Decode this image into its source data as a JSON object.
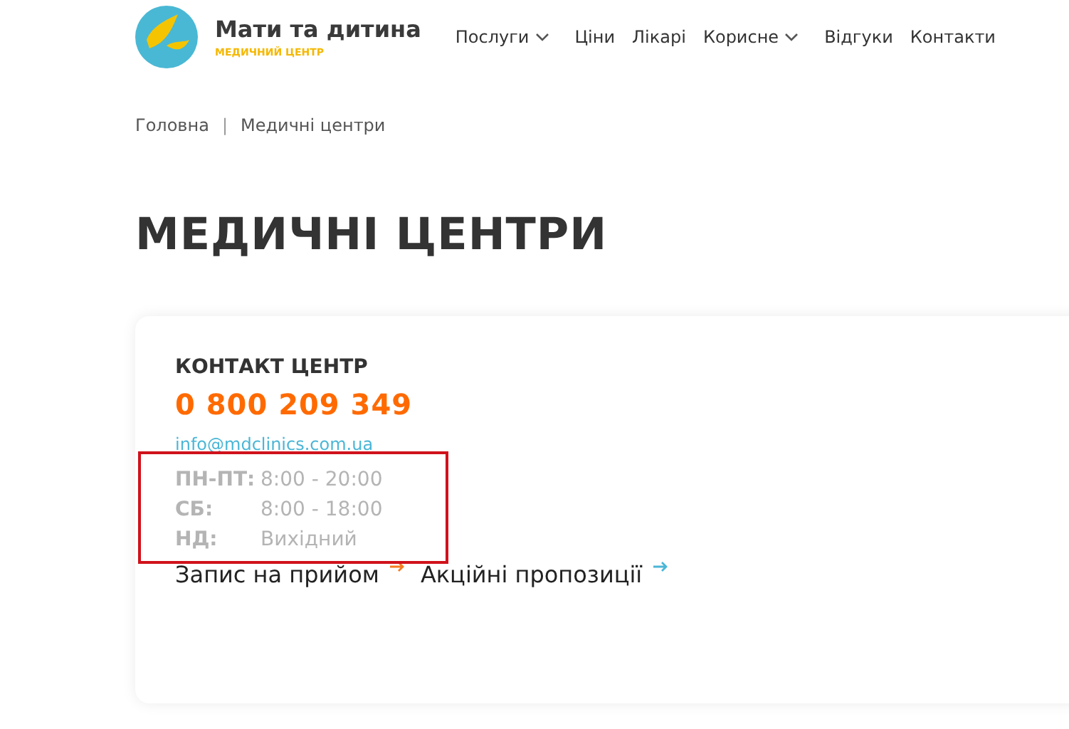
{
  "header": {
    "brand": "Мати та дитина",
    "tagline": "МЕДИЧНИЙ ЦЕНТР",
    "nav": [
      {
        "label": "Послуги",
        "dropdown": true
      },
      {
        "label": "Ціни",
        "dropdown": false
      },
      {
        "label": "Лікарі",
        "dropdown": false
      },
      {
        "label": "Корисне",
        "dropdown": true
      },
      {
        "label": "Відгуки",
        "dropdown": false
      },
      {
        "label": "Контакти",
        "dropdown": false
      }
    ]
  },
  "breadcrumbs": [
    "Головна",
    "Медичні центри"
  ],
  "breadcrumb_separator": "|",
  "page_title": "МЕДИЧНІ ЦЕНТРИ",
  "contact_card": {
    "heading": "КОНТАКТ ЦЕНТР",
    "phone": "0 800 209 349",
    "email": "info@mdclinics.com.ua",
    "hours": [
      {
        "days": "ПН-ПТ:",
        "time": "8:00 - 20:00"
      },
      {
        "days": "СБ:",
        "time": "8:00 - 18:00"
      },
      {
        "days": "НД:",
        "time": "Вихідний"
      }
    ],
    "highlighted": true,
    "links": [
      {
        "label": "Запис на прийом",
        "color": "#f57c20"
      },
      {
        "label": "Акційні пропозиції",
        "color": "#4bb6d6"
      }
    ]
  }
}
